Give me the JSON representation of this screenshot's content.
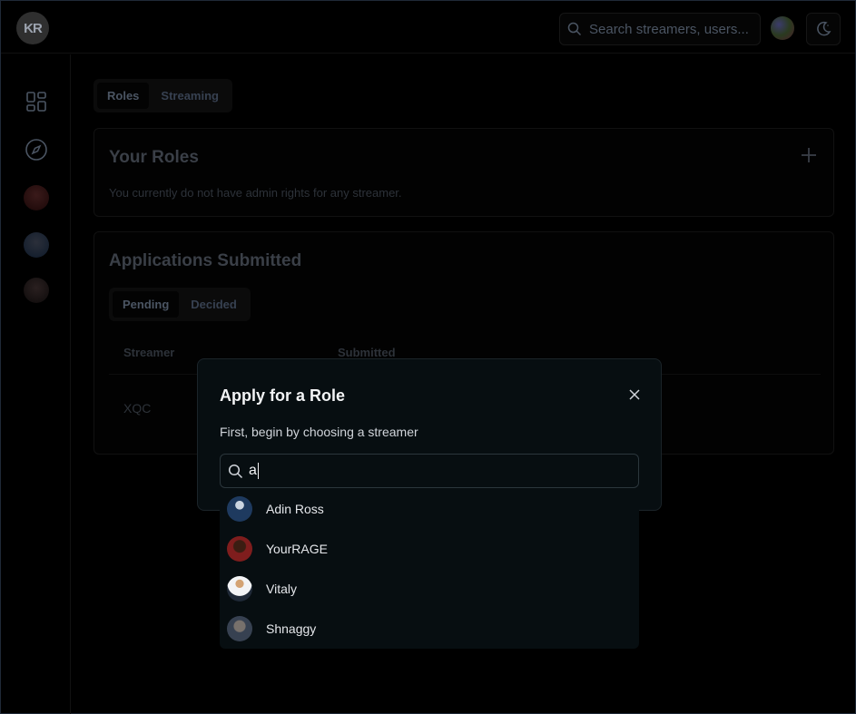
{
  "header": {
    "logo_text": "KR",
    "search_placeholder": "Search streamers, users..."
  },
  "sidebar": {
    "icons": [
      "dashboard-icon",
      "compass-icon"
    ],
    "avatars": [
      "streamer-avatar-1",
      "streamer-avatar-2",
      "streamer-avatar-3"
    ]
  },
  "main": {
    "tabs": [
      {
        "label": "Roles",
        "active": true
      },
      {
        "label": "Streaming",
        "active": false
      }
    ],
    "your_roles": {
      "title": "Your Roles",
      "empty_text": "You currently do not have admin rights for any streamer."
    },
    "applications": {
      "title": "Applications Submitted",
      "tabs": [
        {
          "label": "Pending",
          "active": true
        },
        {
          "label": "Decided",
          "active": false
        }
      ],
      "columns": [
        "Streamer",
        "Submitted"
      ],
      "rows": [
        {
          "streamer": "XQC"
        }
      ]
    }
  },
  "modal": {
    "title": "Apply for a Role",
    "description": "First, begin by choosing a streamer",
    "search_value": "a",
    "options": [
      {
        "label": "Adin Ross",
        "avatar_color": "#1e3a5f"
      },
      {
        "label": "YourRAGE",
        "avatar_color": "#7f1d1d"
      },
      {
        "label": "Vitaly",
        "avatar_color": "#e5e7eb"
      },
      {
        "label": "Shnaggy",
        "avatar_color": "#6b7280"
      }
    ]
  }
}
